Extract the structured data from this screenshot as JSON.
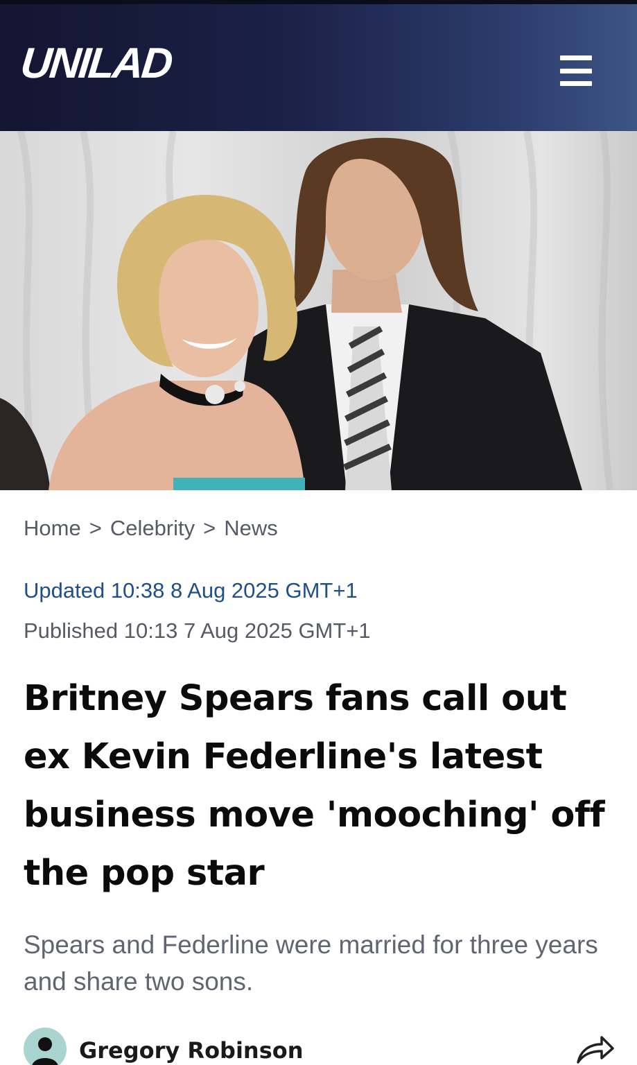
{
  "header": {
    "logo_text": "UNILAD",
    "menu_icon": "hamburger-menu-icon",
    "background_colors": [
      "#131631",
      "#3d5583"
    ]
  },
  "hero": {
    "image_description_icon": "article-hero-photo"
  },
  "breadcrumb": {
    "items": [
      "Home",
      "Celebrity",
      "News"
    ],
    "separator": ">"
  },
  "meta": {
    "updated": "Updated 10:38 8 Aug 2025 GMT+1",
    "published": "Published 10:13 7 Aug 2025 GMT+1",
    "updated_color": "#1f4f8a"
  },
  "article": {
    "headline": "Britney Spears fans call out ex Kevin Federline's latest business move 'mooching' off the pop star",
    "subtitle": "Spears and Federline were married for three years and share two sons."
  },
  "author": {
    "name": "Gregory Robinson",
    "avatar_icon": "user-avatar-icon",
    "share_icon": "share-arrow-icon"
  }
}
